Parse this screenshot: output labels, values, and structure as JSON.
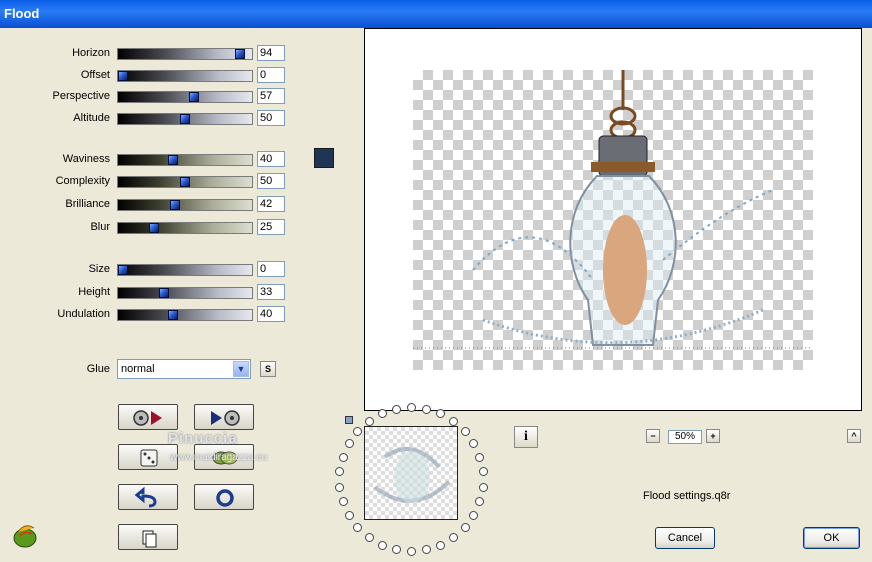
{
  "window": {
    "title": "Flood"
  },
  "sliders": [
    {
      "label": "Horizon",
      "value": 94,
      "display": "94",
      "style": "a"
    },
    {
      "label": "Offset",
      "value": 0,
      "display": "0",
      "style": "a"
    },
    {
      "label": "Perspective",
      "value": 57,
      "display": "57",
      "style": "a"
    },
    {
      "label": "Altitude",
      "value": 50,
      "display": "50",
      "style": "a"
    },
    {
      "label": "Waviness",
      "value": 40,
      "display": "40",
      "style": "b"
    },
    {
      "label": "Complexity",
      "value": 50,
      "display": "50",
      "style": "b"
    },
    {
      "label": "Brilliance",
      "value": 42,
      "display": "42",
      "style": "b"
    },
    {
      "label": "Blur",
      "value": 25,
      "display": "25",
      "style": "b"
    },
    {
      "label": "Size",
      "value": 0,
      "display": "0",
      "style": "a"
    },
    {
      "label": "Height",
      "value": 33,
      "display": "33",
      "style": "a"
    },
    {
      "label": "Undulation",
      "value": 40,
      "display": "40",
      "style": "a"
    }
  ],
  "flood_color": "#1f3556",
  "glue": {
    "label": "Glue",
    "selected": "normal",
    "side_button": "S"
  },
  "watermark": {
    "line1": "Pinuccia",
    "line2": "www.maidiragazza.eu"
  },
  "zoom": {
    "value": "50%",
    "minus": "−",
    "plus": "+"
  },
  "info_button": "i",
  "expand_button": "^",
  "settings_file": "Flood settings.q8r",
  "buttons": {
    "cancel": "Cancel",
    "ok": "OK"
  }
}
